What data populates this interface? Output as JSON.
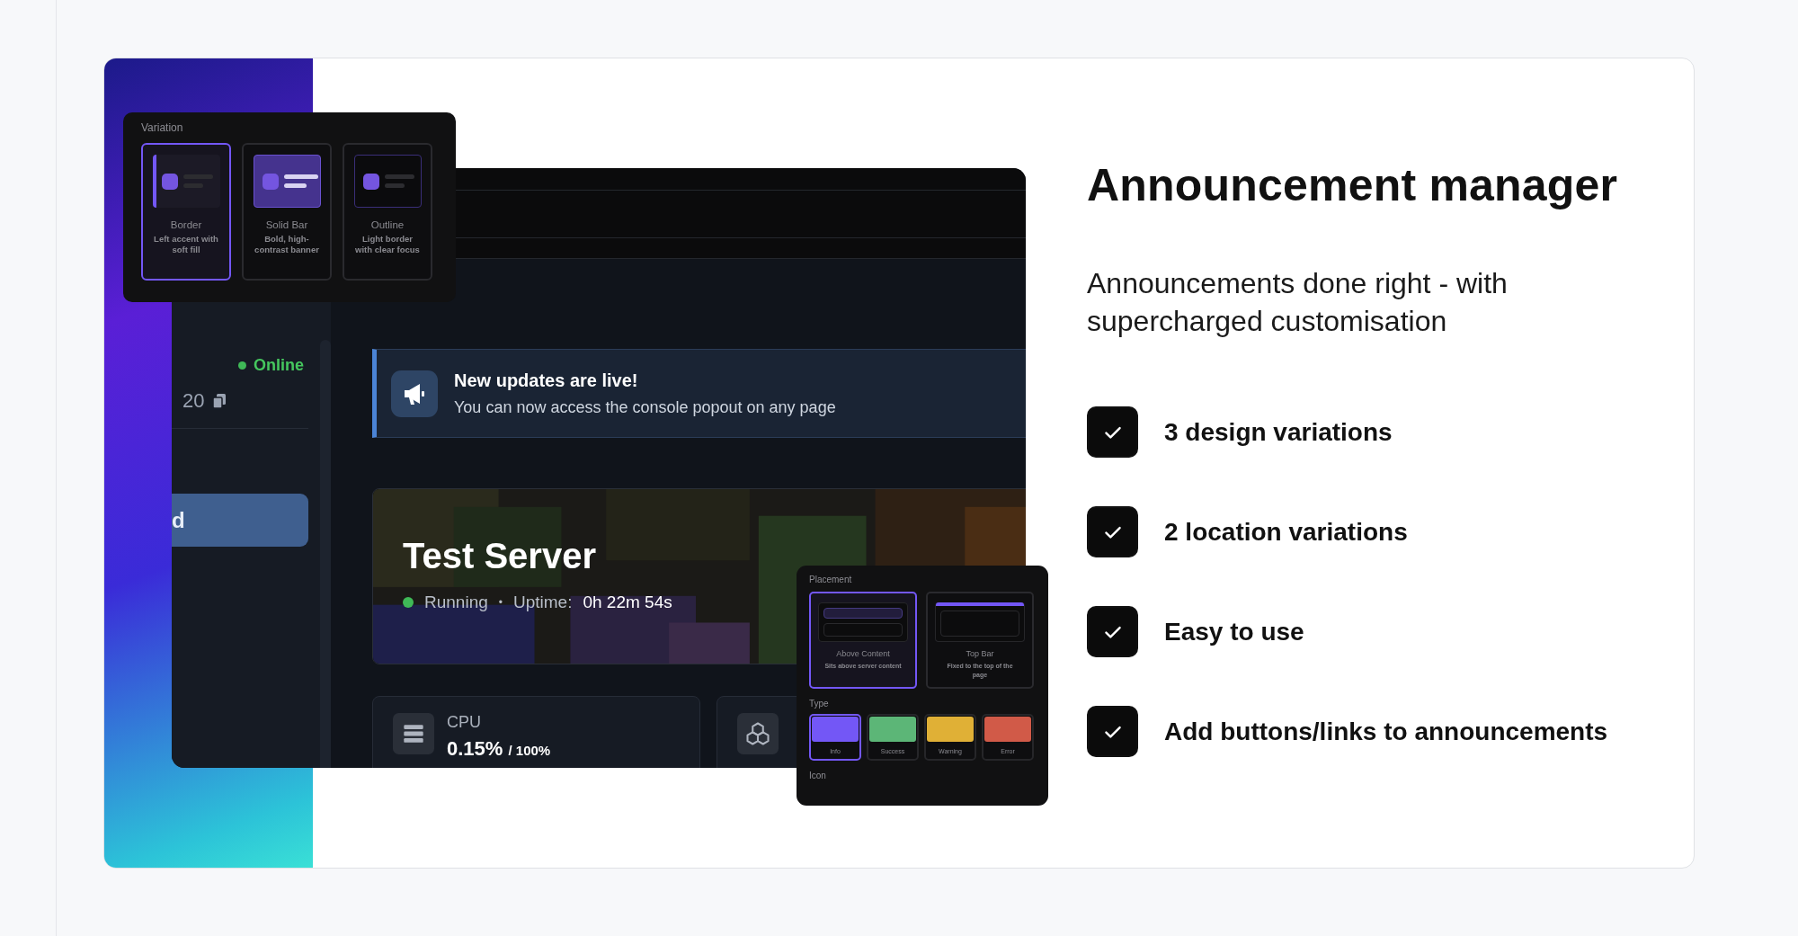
{
  "feature": {
    "title": "Announcement manager",
    "subtitle": "Announcements done right - with supercharged customisation",
    "items": [
      {
        "label": "3 design variations",
        "checked": true
      },
      {
        "label": "2 location variations",
        "checked": true
      },
      {
        "label": "Easy to use",
        "checked": true
      },
      {
        "label": "Add buttons/links to announcements",
        "checked": true
      }
    ]
  },
  "preview": {
    "sidebar": {
      "status": "Online",
      "address": "20",
      "nav_item": {
        "label": "d",
        "selected": true
      }
    },
    "announcement": {
      "title": "New updates are live!",
      "message": "You can now access the console popout on any page"
    },
    "server": {
      "name": "Test Server",
      "status": "Running",
      "separator": "•",
      "uptime_label": "Uptime:",
      "uptime": "0h 22m 54s"
    },
    "stats": [
      {
        "kind": "cpu",
        "label": "CPU",
        "value": "0.15%",
        "limit": "/ 100%"
      },
      {
        "kind": "blocks"
      }
    ]
  },
  "variation_panel": {
    "title": "Variation",
    "options": [
      {
        "kind": "border",
        "name": "Border",
        "description": "Left accent with soft fill",
        "selected": true
      },
      {
        "kind": "solid",
        "name": "Solid Bar",
        "description": "Bold, high-contrast banner",
        "selected": false
      },
      {
        "kind": "outline",
        "name": "Outline",
        "description": "Light border with clear focus",
        "selected": false
      }
    ]
  },
  "placement_panel": {
    "title": "Placement",
    "options": [
      {
        "kind": "above",
        "name": "Above Content",
        "description": "Sits above server content",
        "selected": true
      },
      {
        "kind": "topbar",
        "name": "Top Bar",
        "description": "Fixed to the top of the page",
        "selected": false
      }
    ],
    "type_title": "Type",
    "types": [
      {
        "label": "Info",
        "color": "#7357f6",
        "selected": true
      },
      {
        "label": "Success",
        "color": "#5cb677",
        "selected": false
      },
      {
        "label": "Warning",
        "color": "#e0b036",
        "selected": false
      },
      {
        "label": "Error",
        "color": "#d15a48",
        "selected": false
      }
    ],
    "icon_title": "Icon"
  }
}
